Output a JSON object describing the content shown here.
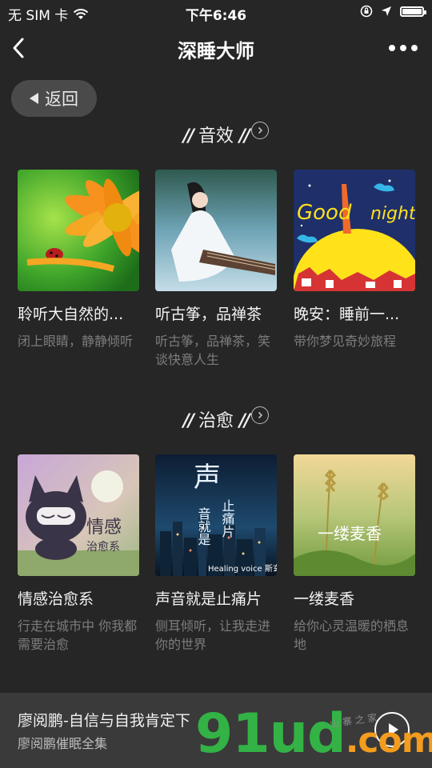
{
  "status_bar": {
    "carrier": "无 SIM 卡",
    "time": "下午6:46"
  },
  "nav": {
    "title": "深睡大师"
  },
  "back_button": {
    "label": "返回"
  },
  "sections": [
    {
      "title": "音效",
      "items": [
        {
          "title": "聆听大自然的...",
          "desc": "闭上眼睛，静静倾听"
        },
        {
          "title": "听古筝，品禅茶",
          "desc": "听古筝，品禅茶，笑谈快意人生"
        },
        {
          "title": "晚安：睡前一...",
          "desc": "带你梦见奇妙旅程"
        }
      ]
    },
    {
      "title": "治愈",
      "items": [
        {
          "title": "情感治愈系",
          "desc": "行走在城市中 你我都需要治愈"
        },
        {
          "title": "声音就是止痛片",
          "desc": "侧耳倾听，让我走进你的世界"
        },
        {
          "title": "一缕麦香",
          "desc": "给你心灵温暖的栖息地"
        }
      ]
    }
  ],
  "artwork_text": {
    "good_night_1": "Good",
    "good_night_2": "night",
    "healing_1": "情感",
    "healing_2": "治愈系",
    "sound_1": "声",
    "sound_2": "止痛片",
    "sound_3": "音就是",
    "sound_4": "Healing voice 斯玄",
    "wheat": "一缕麦香"
  },
  "player": {
    "title": "廖阅鹏-自信与自我肯定下",
    "subtitle": "廖阅鹏催眠全集"
  },
  "watermark": {
    "main": "91ud",
    "suffix": ".com",
    "small": "山 寨 之 家"
  }
}
